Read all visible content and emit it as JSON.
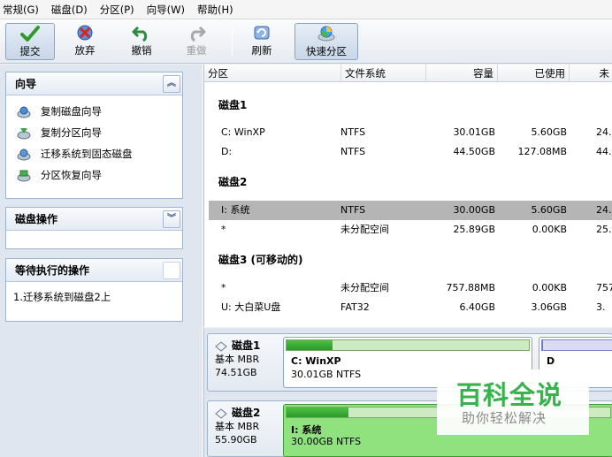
{
  "menu": [
    "常规(G)",
    "磁盘(D)",
    "分区(P)",
    "向导(W)",
    "帮助(H)"
  ],
  "toolbar": {
    "submit": "提交",
    "discard": "放弃",
    "undo": "撤销",
    "redo": "重做",
    "refresh": "刷新",
    "quick_partition": "快速分区"
  },
  "wizard_panel": {
    "title": "向导",
    "items": [
      "复制磁盘向导",
      "复制分区向导",
      "迁移系统到固态磁盘",
      "分区恢复向导"
    ]
  },
  "disk_ops_panel": {
    "title": "磁盘操作"
  },
  "pending_panel": {
    "title": "等待执行的操作",
    "items": [
      "1.迁移系统到磁盘2上"
    ]
  },
  "table": {
    "columns": [
      "分区",
      "文件系统",
      "容量",
      "已使用",
      "未"
    ],
    "groups": [
      {
        "title": "磁盘1",
        "rows": [
          {
            "partition": "C: WinXP",
            "fs": "NTFS",
            "capacity": "30.01GB",
            "used": "5.60GB",
            "unused": "24."
          },
          {
            "partition": "D:",
            "fs": "NTFS",
            "capacity": "44.50GB",
            "used": "127.08MB",
            "unused": "44."
          }
        ]
      },
      {
        "title": "磁盘2",
        "rows": [
          {
            "partition": "I: 系统",
            "fs": "NTFS",
            "capacity": "30.00GB",
            "used": "5.60GB",
            "unused": "24.",
            "selected": true
          },
          {
            "partition": "*",
            "fs": "未分配空间",
            "capacity": "25.89GB",
            "used": "0.00KB",
            "unused": "25."
          }
        ]
      },
      {
        "title": "磁盘3 (可移动的)",
        "rows": [
          {
            "partition": "*",
            "fs": "未分配空间",
            "capacity": "757.88MB",
            "used": "0.00KB",
            "unused": "757."
          },
          {
            "partition": "U: 大白菜U盘",
            "fs": "FAT32",
            "capacity": "6.40GB",
            "used": "3.06GB",
            "unused": "3."
          }
        ]
      }
    ]
  },
  "disk_map": [
    {
      "name": "磁盘1",
      "type": "基本 MBR",
      "size": "74.51GB",
      "partitions": [
        {
          "name": "C: WinXP",
          "desc": "30.01GB NTFS",
          "used_fraction": 0.19
        },
        {
          "name": "D",
          "desc": "",
          "used_fraction": 0.01
        }
      ]
    },
    {
      "name": "磁盘2",
      "type": "基本 MBR",
      "size": "55.90GB",
      "partitions": [
        {
          "name": "I: 系统",
          "desc": "30.00GB NTFS",
          "used_fraction": 0.19,
          "selected": true
        }
      ]
    }
  ],
  "watermark": {
    "title": "百科全说",
    "subtitle": "助你轻松解决"
  }
}
